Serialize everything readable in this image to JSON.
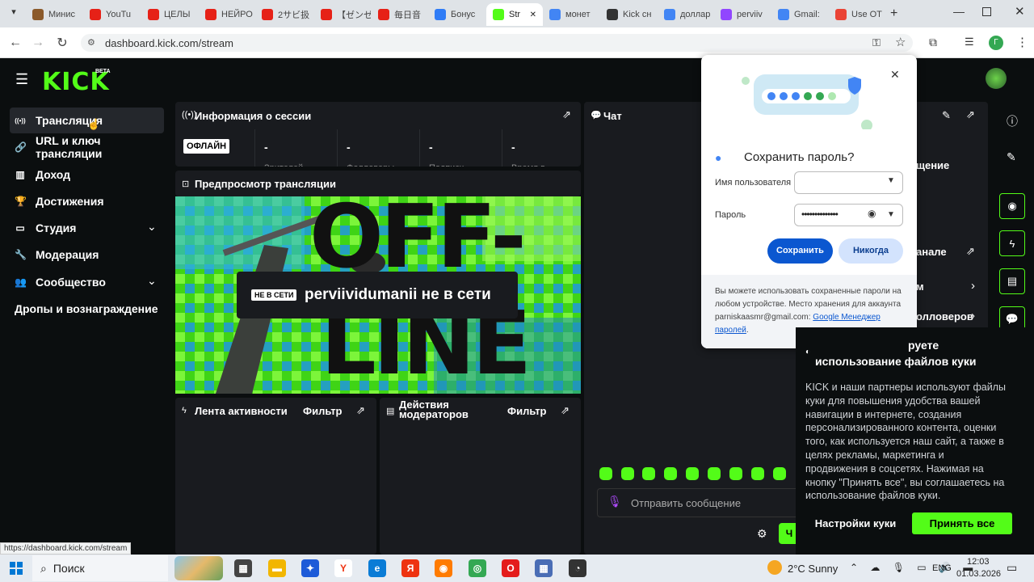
{
  "browser": {
    "tabs": [
      {
        "label": "Минис",
        "color": "#8b5a2b"
      },
      {
        "label": "YouTu",
        "color": "#e62117"
      },
      {
        "label": "ЦЕЛЫ",
        "color": "#e62117"
      },
      {
        "label": "НЕЙРО",
        "color": "#e62117"
      },
      {
        "label": "2サビ扱",
        "color": "#e62117"
      },
      {
        "label": "【ゼンゼ",
        "color": "#e62117"
      },
      {
        "label": "毎日音",
        "color": "#e62117"
      },
      {
        "label": "Бонус",
        "color": "#2f7cf6"
      },
      {
        "label": "Str",
        "color": "#53fc18"
      },
      {
        "label": "монет",
        "color": "#4285f4"
      },
      {
        "label": "Kick сн",
        "color": "#333333"
      },
      {
        "label": "доллар",
        "color": "#4285f4"
      },
      {
        "label": "perviiv",
        "color": "#9146ff"
      },
      {
        "label": "Gmail:",
        "color": "#4285f4"
      },
      {
        "label": "Use OT",
        "color": "#ea4335"
      }
    ],
    "url": "dashboard.kick.com/stream",
    "status_url": "https://dashboard.kick.com/stream",
    "profile_letter": "Г"
  },
  "brand": {
    "logo": "KICK",
    "beta": "BETA",
    "accent": "#53fc18"
  },
  "sidebar": {
    "items": [
      {
        "label": "Трансляция",
        "icon": "broadcast-icon"
      },
      {
        "label": "URL и ключ трансляции",
        "icon": "link-icon"
      },
      {
        "label": "Доход",
        "icon": "chart-icon"
      },
      {
        "label": "Достижения",
        "icon": "trophy-icon"
      },
      {
        "label": "Студия",
        "icon": "studio-icon"
      },
      {
        "label": "Модерация",
        "icon": "wrench-icon"
      },
      {
        "label": "Сообщество",
        "icon": "people-icon"
      },
      {
        "label": "Дропы и вознаграждение",
        "icon": ""
      }
    ]
  },
  "session": {
    "title": "Информация о сессии",
    "status": "ОФЛАЙН",
    "stats": [
      {
        "value": "-",
        "label": "Зрителей"
      },
      {
        "value": "-",
        "label": "Фолловеры"
      },
      {
        "value": "-",
        "label": "Подписч"
      },
      {
        "value": "-",
        "label": "Время в"
      }
    ]
  },
  "preview": {
    "title": "Предпросмотр трансляции",
    "badge": "НЕ В СЕТИ",
    "message": "perviividumanii не в сети",
    "bg_text_1": "OFF-",
    "bg_text_2": "LINE"
  },
  "activity": {
    "title": "Лента активности",
    "filter": "Фильтр"
  },
  "mod_actions": {
    "title": "Действия модераторов",
    "filter": "Фильтр"
  },
  "chat": {
    "title": "Чат",
    "placeholder": "Отправить сообщение",
    "send_label": "Ч"
  },
  "right_panels": {
    "partial_1": "щение",
    "partial_2": "анале",
    "partial_3": "м",
    "partial_4": "олловеров"
  },
  "password_popup": {
    "title": "Сохранить пароль?",
    "username_label": "Имя пользователя",
    "password_label": "Пароль",
    "password_value": "••••••••••••••",
    "save": "Сохранить",
    "never": "Никогда",
    "footer": "Вы можете использовать сохраненные пароли на любом устройстве. Место хранения для аккаунта parniskaasmr@gmail.com:",
    "footer_link": "Google Менеджер паролей",
    "footer_end": "."
  },
  "cookie": {
    "title_partial": "руете",
    "title": "использование файлов куки",
    "body": "KICK и наши партнеры используют файлы куки для повышения удобства вашей навигации в интернете, создания персонализированного контента, оценки того, как используется наш сайт, а также в целях рекламы, маркетинга и продвижения в соцсетях. Нажимая на кнопку \"Принять все\", вы соглашаетесь на использование файлов куки.",
    "settings": "Настройки куки",
    "accept": "Принять все"
  },
  "taskbar": {
    "search": "Поиск",
    "weather": "2°C  Sunny",
    "lang": "ENG",
    "time": "12:03",
    "date": "01.03.2026"
  }
}
